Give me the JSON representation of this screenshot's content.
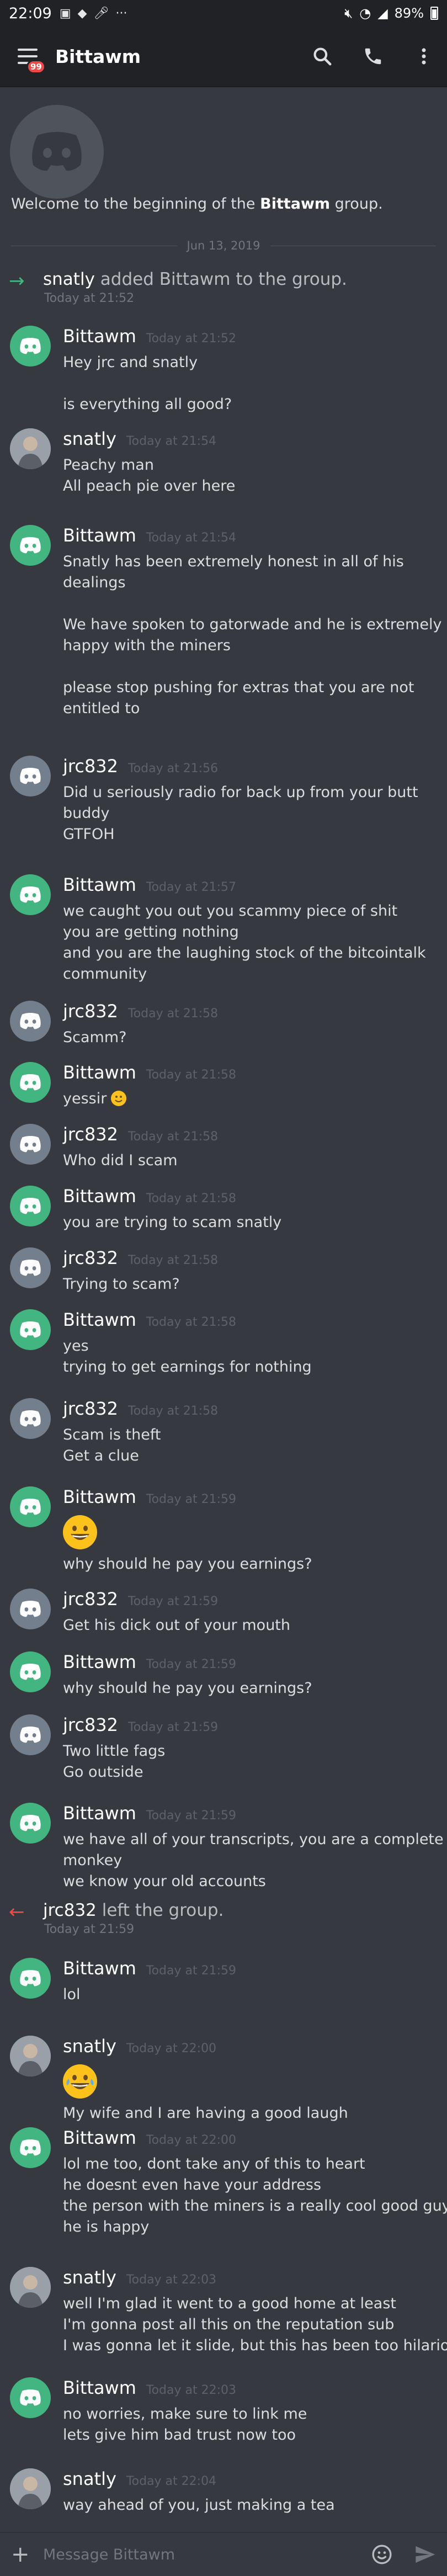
{
  "status_bar": {
    "time": "22:09",
    "battery": "89%"
  },
  "header": {
    "title": "Bittawm",
    "badge": "99"
  },
  "intro": {
    "welcome_prefix": "Welcome to the beginning of the ",
    "group_name": "Bittawm",
    "welcome_suffix": " group."
  },
  "date_divider": "Jun 13, 2019",
  "system_add": {
    "actor": "snatly",
    "text": " added Bittawm to the group.",
    "time": "Today at 21:52"
  },
  "system_leave": {
    "actor": "jrc832",
    "text": " left the group.",
    "time": "Today at 21:59"
  },
  "messages": [
    {
      "author": "Bittawm",
      "time": "Today at 21:52",
      "lines": [
        "Hey jrc and snatly",
        "",
        "is everything all good?"
      ]
    },
    {
      "author": "snatly",
      "time": "Today at 21:54",
      "lines": [
        "Peachy man",
        "All peach pie over here"
      ]
    },
    {
      "author": "Bittawm",
      "time": "Today at 21:54",
      "lines": [
        "Snatly has been extremely honest in all of his",
        "dealings",
        "",
        "We have spoken to gatorwade and he is extremely",
        "happy  with the miners",
        "",
        "please stop pushing for extras that you are not",
        "entitled to"
      ]
    },
    {
      "author": "jrc832",
      "time": "Today at 21:56",
      "lines": [
        "Did u seriously radio for back up from your butt",
        "buddy",
        "GTFOH"
      ]
    },
    {
      "author": "Bittawm",
      "time": "Today at 21:57",
      "lines": [
        "we caught you out you scammy piece of shit",
        "you are getting nothing",
        "and you are the laughing stock of the bitcointalk",
        "community"
      ]
    },
    {
      "author": "jrc832",
      "time": "Today at 21:58",
      "lines": [
        "Scamm?"
      ]
    },
    {
      "author": "Bittawm",
      "time": "Today at 21:58",
      "lines": [
        "yessir"
      ]
    },
    {
      "author": "jrc832",
      "time": "Today at 21:58",
      "lines": [
        "Who did I scam"
      ]
    },
    {
      "author": "Bittawm",
      "time": "Today at 21:58",
      "lines": [
        "you are trying to scam snatly"
      ]
    },
    {
      "author": "jrc832",
      "time": "Today at 21:58",
      "lines": [
        "Trying to scam?"
      ]
    },
    {
      "author": "Bittawm",
      "time": "Today at 21:58",
      "lines": [
        "yes",
        "trying to get earnings for nothing"
      ]
    },
    {
      "author": "jrc832",
      "time": "Today at 21:58",
      "lines": [
        "Scam is theft",
        "Get a clue"
      ]
    },
    {
      "author": "Bittawm",
      "time": "Today at 21:59",
      "lines": [
        "why should he pay you earnings?"
      ]
    },
    {
      "author": "jrc832",
      "time": "Today at 21:59",
      "lines": [
        "Get his dick out of your mouth"
      ]
    },
    {
      "author": "Bittawm",
      "time": "Today at 21:59",
      "lines": [
        "why should he pay you earnings?"
      ]
    },
    {
      "author": "jrc832",
      "time": "Today at 21:59",
      "lines": [
        "Two little fags",
        "Go outside"
      ]
    },
    {
      "author": "Bittawm",
      "time": "Today at 21:59",
      "lines": [
        "we have all of your transcripts, you are a complete",
        "monkey",
        "we know your old accounts"
      ]
    },
    {
      "author": "Bittawm",
      "time": "Today at 21:59",
      "lines": [
        "lol"
      ]
    },
    {
      "author": "snatly",
      "time": "Today at 22:00",
      "lines": [
        "My wife and I are having a good laugh"
      ]
    },
    {
      "author": "Bittawm",
      "time": "Today at 22:00",
      "lines": [
        "lol me too, dont take any of this to heart",
        "he doesnt even have your address",
        "the person with the miners is a really cool good guy,",
        "he is happy"
      ]
    },
    {
      "author": "snatly",
      "time": "Today at 22:03",
      "lines": [
        "well I'm glad it went to a good home at least",
        "I'm gonna post all this on the reputation sub",
        "I was gonna let it slide, but this has been too hilarious"
      ]
    },
    {
      "author": "Bittawm",
      "time": "Today at 22:03",
      "lines": [
        "no worries, make sure to link me",
        "lets give him bad trust now too"
      ]
    },
    {
      "author": "snatly",
      "time": "Today at 22:04",
      "lines": [
        "way ahead of you, just making a tea"
      ]
    }
  ],
  "composer": {
    "placeholder": "Message Bittawm"
  },
  "icons": {
    "menu": "menu-icon",
    "search": "search-icon",
    "call": "phone-icon",
    "more": "more-vert-icon",
    "add": "plus-icon",
    "emoji": "emoji-icon",
    "send": "send-icon",
    "join": "join-arrow-icon",
    "leave": "leave-arrow-icon"
  },
  "colors": {
    "background": "#36393f",
    "header": "#202225",
    "bot_green": "#43b581",
    "grey_avatar": "#747f8d",
    "leave_red": "#f04747"
  }
}
